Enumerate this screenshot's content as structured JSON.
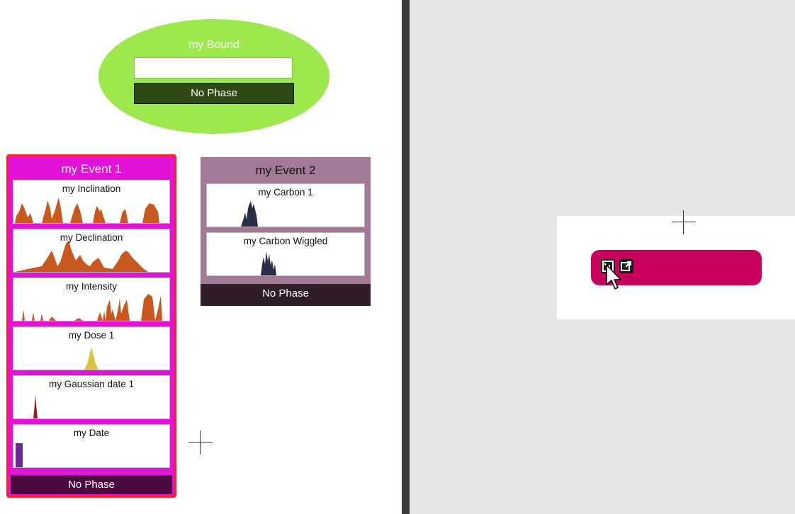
{
  "bound": {
    "title": "my Bound",
    "input_value": "",
    "phase_label": "No Phase",
    "colors": {
      "fill": "#9de84d",
      "phase_bg": "#2f4a14"
    }
  },
  "event1": {
    "title": "my Event 1",
    "phase_label": "No Phase",
    "border_color": "#ff1e2c",
    "fill_color": "#e212d9",
    "dates": [
      {
        "label": "my Inclination"
      },
      {
        "label": "my Declination"
      },
      {
        "label": "my Intensity"
      },
      {
        "label": "my Dose 1"
      },
      {
        "label": "my Gaussian date 1"
      },
      {
        "label": "my Date"
      }
    ]
  },
  "event2": {
    "title": "my Event 2",
    "phase_label": "No Phase",
    "fill_color": "#a27a95",
    "dates": [
      {
        "label": "my Carbon 1"
      },
      {
        "label": "my Carbon Wiggled"
      }
    ]
  },
  "overview": {
    "pill_color": "#c8005d",
    "buttons": [
      {
        "icon": "import-icon"
      },
      {
        "icon": "external-link-icon"
      }
    ]
  }
}
